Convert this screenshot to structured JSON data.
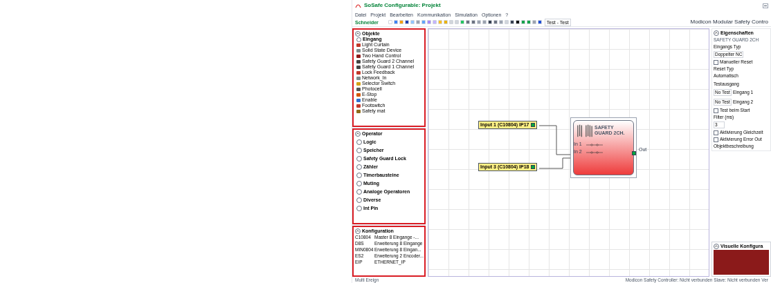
{
  "window": {
    "title": "SoSafe Configurable: Projekt"
  },
  "menu": [
    "Datei",
    "Projekt",
    "Bearbeiten",
    "Kommunikation",
    "Simulation",
    "Optionen",
    "?"
  ],
  "toolbar": {
    "logo": "Schneider",
    "mode": "Test - Test",
    "device_title": "Modicon Modular Safety Contro"
  },
  "objects": {
    "title": "Objekte",
    "expanded": true,
    "group": "Eingang",
    "items": [
      {
        "label": "Light Curtain",
        "color": "#c0392b"
      },
      {
        "label": "Solid State Device",
        "color": "#7f8c8d"
      },
      {
        "label": "Two Hand Control",
        "color": "#8e1b1b"
      },
      {
        "label": "Safety Guard 2 Channel",
        "color": "#444444"
      },
      {
        "label": "Safety Guard 1 Channel",
        "color": "#444444"
      },
      {
        "label": "Lock Feedback",
        "color": "#c0392b"
      },
      {
        "label": "Network_In",
        "color": "#7f8c8d"
      },
      {
        "label": "Selector Switch",
        "color": "#d4a017"
      },
      {
        "label": "Photocell",
        "color": "#555555"
      },
      {
        "label": "E-Stop",
        "color": "#d35400"
      },
      {
        "label": "Enable",
        "color": "#2e6fd1"
      },
      {
        "label": "Footswitch",
        "color": "#c0392b"
      },
      {
        "label": "Safety mat",
        "color": "#8e6b1b"
      }
    ]
  },
  "operators": {
    "title": "Operator",
    "expanded": true,
    "groups": [
      "Logic",
      "Speicher",
      "Safety Guard Lock",
      "Zähler",
      "Timerbausteine",
      "Muting",
      "Analoge Operatoren",
      "Diverse",
      "Int Pin"
    ]
  },
  "configuration": {
    "title": "Konfiguration",
    "expanded": true,
    "rows": [
      [
        "C10804",
        "Master 8 Eingange -..."
      ],
      [
        "D8S",
        "Erweiterung 8 Eingange"
      ],
      [
        "MIN0804",
        "Erweiterung 8 Eingan..."
      ],
      [
        "ES2",
        "Erweiterung 2 Encoder..."
      ],
      [
        "EIP",
        "ETHERNET_IP"
      ]
    ]
  },
  "canvas": {
    "inputs": [
      "Input 1 (C10804) IP17",
      "Input 3 (C10804) IP18"
    ],
    "block": {
      "title": "SAFETY GUARD 2CH.",
      "pins": [
        "In 1",
        "In 2"
      ],
      "output": "Out"
    }
  },
  "properties": {
    "title": "Eigenschaften",
    "subtitle": "SAFETY GUARD 2CH",
    "input_type_label": "Eingangs Typ",
    "input_type": "Doppelter NC",
    "manual_reset": {
      "label": "Manueller Reset",
      "checked": false
    },
    "reset_type_label": "Reset Typ",
    "reset_type": "Automatisch",
    "test_output_label": "Testausgang",
    "tests": [
      {
        "value": "No Test",
        "label": "Eingang 1"
      },
      {
        "value": "No Test",
        "label": "Eingang 2"
      }
    ],
    "test_on_start": {
      "label": "Test beim Start",
      "checked": false
    },
    "filter_label": "Filter (ms)",
    "filter": "3",
    "activation_equal": {
      "label": "Aktivierung Gleichzeit",
      "checked": false
    },
    "activation_error": {
      "label": "Aktivierung Error Out",
      "checked": false
    },
    "description_label": "Objektbeschreibung"
  },
  "visual": {
    "title": "Visuelle Konfigura"
  },
  "status_bar": {
    "left": "Multi Ereign",
    "right": "Modicon Safety Controller: Nicht verbunden   Slave: Nicht verbunden   Ver"
  }
}
